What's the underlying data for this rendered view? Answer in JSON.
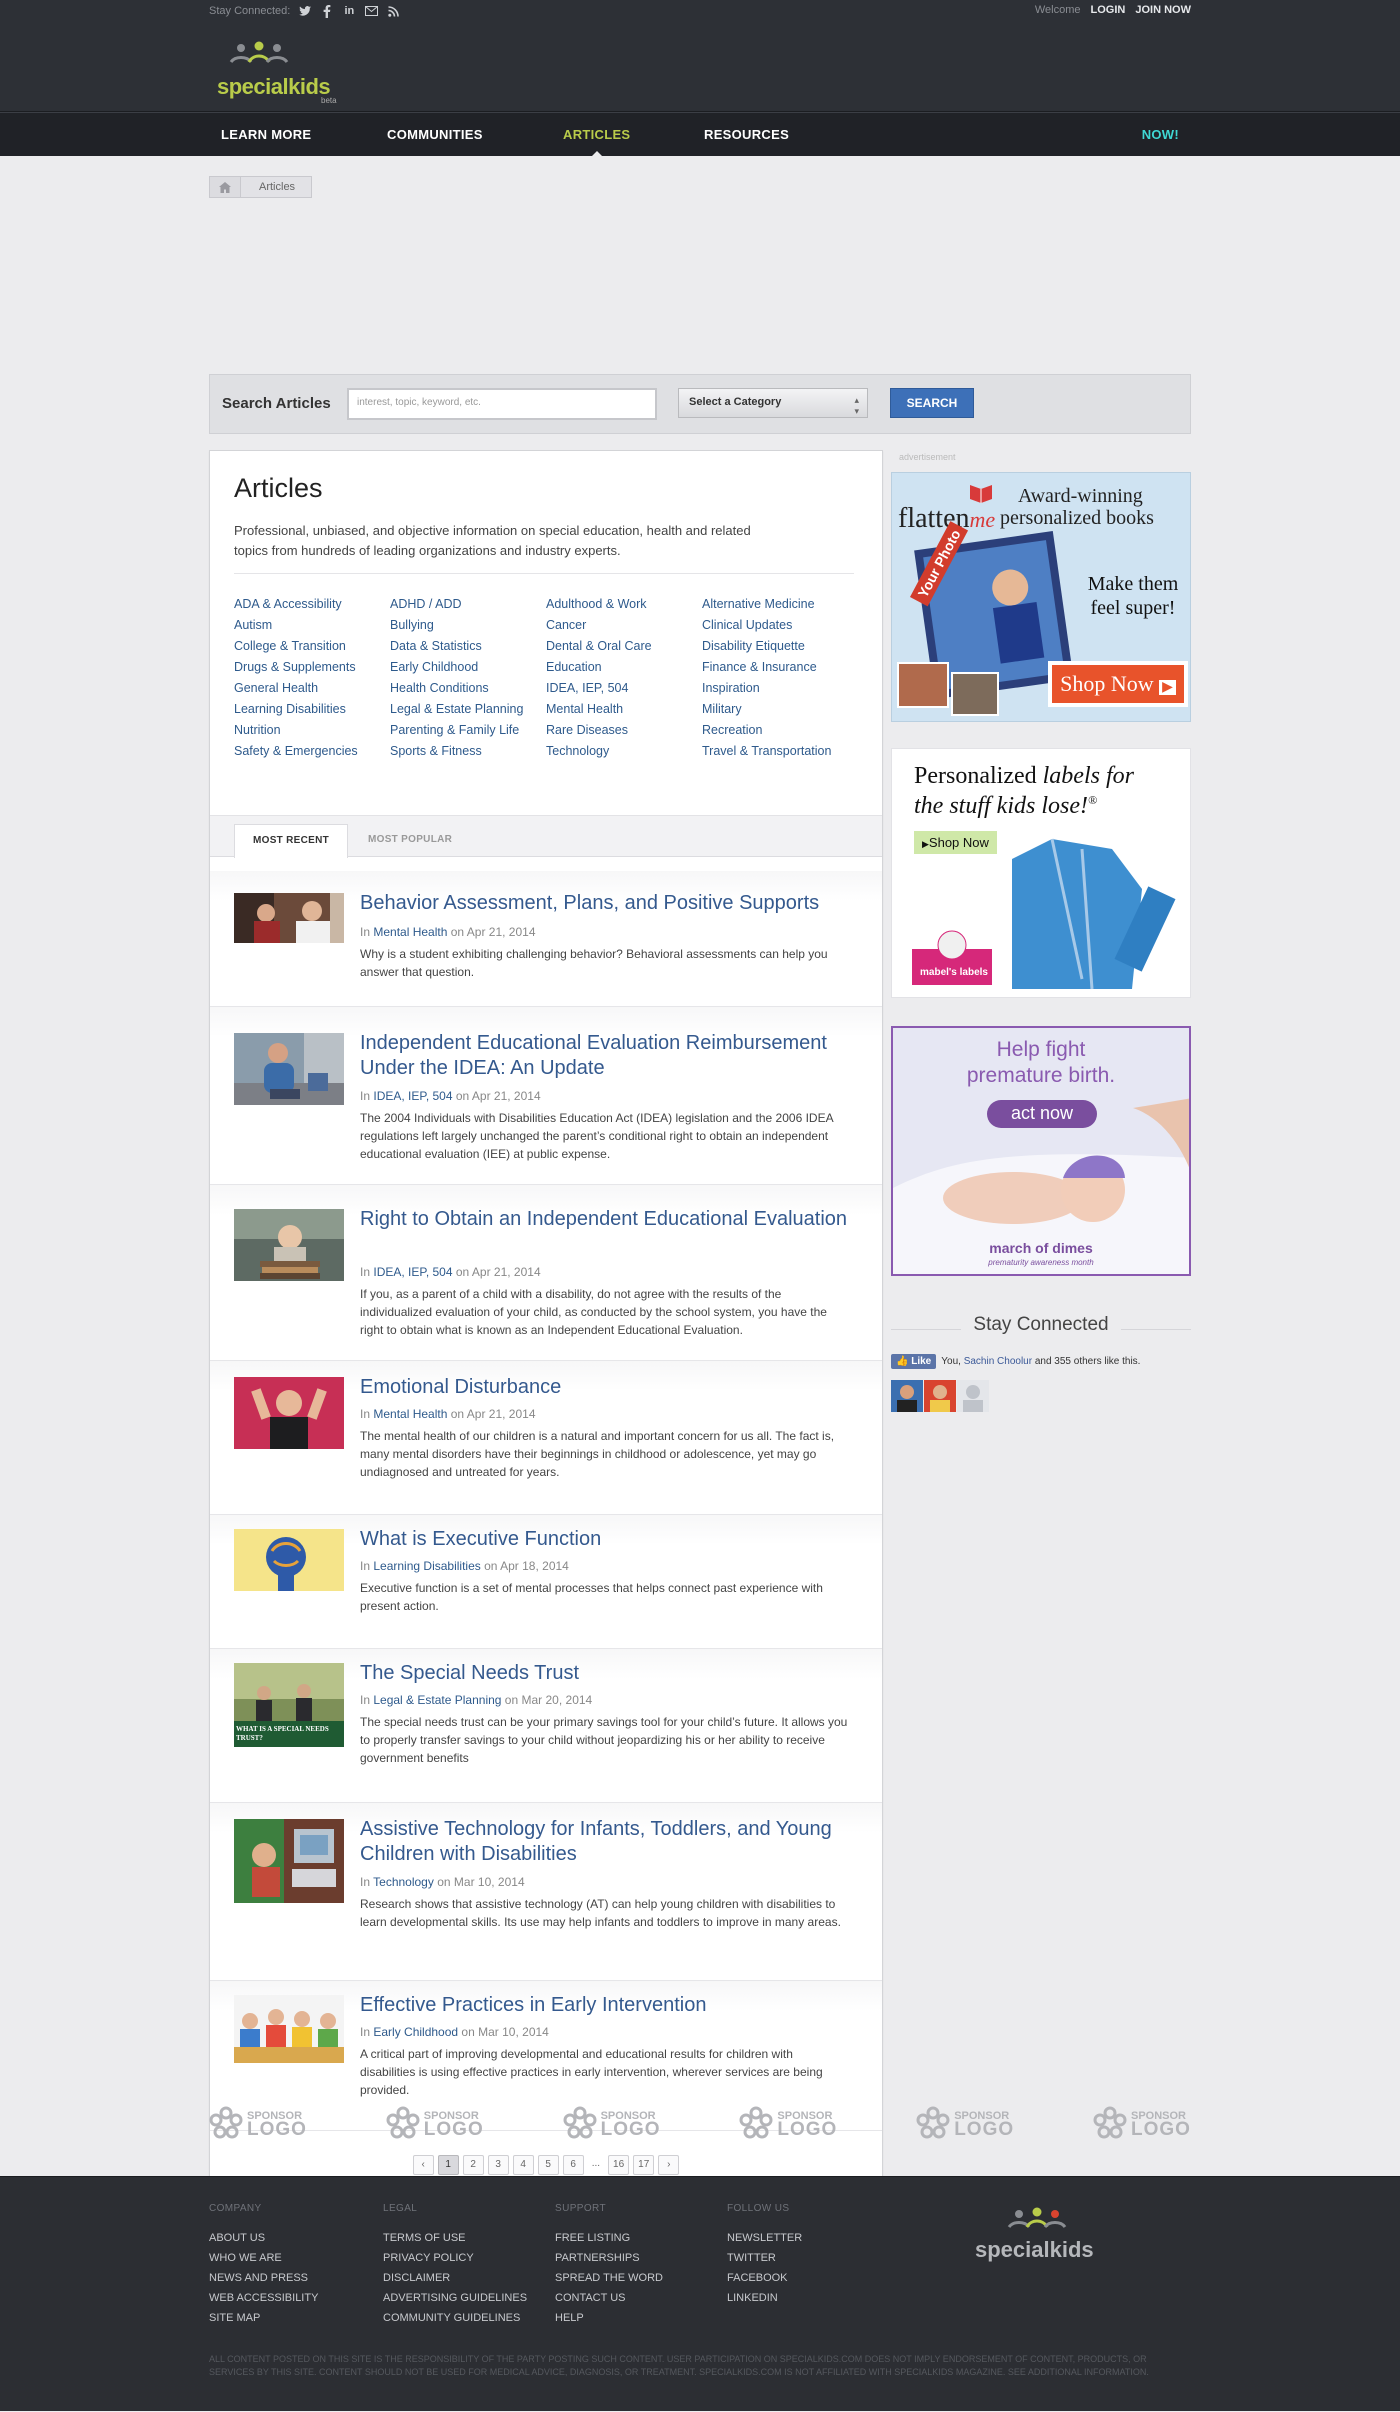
{
  "header": {
    "stay_connected": "Stay Connected:",
    "social_icons": [
      "twitter-icon",
      "facebook-icon",
      "linkedin-icon",
      "email-icon",
      "rss-icon"
    ],
    "welcome": "Welcome",
    "login": "LOGIN",
    "join": "JOIN NOW",
    "logo_text": "specialkids",
    "logo_beta": "beta"
  },
  "nav": {
    "items": [
      "LEARN MORE",
      "COMMUNITIES",
      "ARTICLES",
      "RESOURCES"
    ],
    "active": "ARTICLES",
    "now": "NOW!"
  },
  "breadcrumb": {
    "home_icon": "home-icon",
    "current": "Articles"
  },
  "search": {
    "label": "Search Articles",
    "placeholder": "interest, topic, keyword, etc.",
    "category": "Select a Category",
    "button": "SEARCH"
  },
  "articles_page": {
    "title": "Articles",
    "intro": "Professional, unbiased, and objective information on special education, health and related topics from hundreds of leading organizations and industry experts.",
    "categories": [
      "ADA & Accessibility",
      "ADHD / ADD",
      "Adulthood & Work",
      "Alternative Medicine",
      "Autism",
      "Bullying",
      "Cancer",
      "Clinical Updates",
      "College & Transition",
      "Data & Statistics",
      "Dental & Oral Care",
      "Disability Etiquette",
      "Drugs & Supplements",
      "Early Childhood",
      "Education",
      "Finance & Insurance",
      "General Health",
      "Health Conditions",
      "IDEA, IEP, 504",
      "Inspiration",
      "Learning Disabilities",
      "Legal & Estate Planning",
      "Mental Health",
      "Military",
      "Nutrition",
      "Parenting & Family Life",
      "Rare Diseases",
      "Recreation",
      "Safety & Emergencies",
      "Sports & Fitness",
      "Technology",
      "Travel & Transportation"
    ],
    "tabs": [
      "MOST RECENT",
      "MOST POPULAR"
    ],
    "in_label": "In",
    "on_label": "on",
    "list": [
      {
        "title": "Behavior Assessment, Plans, and Positive Supports",
        "category": "Mental Health",
        "date": "Apr 21, 2014",
        "desc": "Why is a student exhibiting challenging behavior? Behavioral assessments can help you answer that question."
      },
      {
        "title": "Independent Educational Evaluation Reimbursement Under the IDEA: An Update",
        "category": "IDEA, IEP, 504",
        "date": "Apr 21, 2014",
        "desc": "The 2004 Individuals with Disabilities Education Act (IDEA) legislation and the 2006 IDEA regulations left largely unchanged the parent’s conditional right to obtain an independent educational evaluation (IEE) at public expense."
      },
      {
        "title": "Right to Obtain an Independent Educational Evaluation",
        "category": "IDEA, IEP, 504",
        "date": "Apr 21, 2014",
        "desc": "If you, as a parent of a child with a disability, do not agree with the results of the individualized evaluation of your child, as conducted by the school system, you have the right to obtain what is known as an Independent Educational Evaluation."
      },
      {
        "title": "Emotional Disturbance",
        "category": "Mental Health",
        "date": "Apr 21, 2014",
        "desc": "The mental health of our children is a natural and important concern for us all. The fact is, many mental disorders have their beginnings in childhood or adolescence, yet may go undiagnosed and untreated for years."
      },
      {
        "title": "What is Executive Function",
        "category": "Learning Disabilities",
        "date": "Apr 18, 2014",
        "desc": "Executive function is a set of mental processes that helps connect past experience with present action."
      },
      {
        "title": "The Special Needs Trust",
        "category": "Legal & Estate Planning",
        "date": "Mar 20, 2014",
        "desc": "The special needs trust can be your primary savings tool for your child’s future. It allows you to properly transfer savings to your child without jeopardizing his or her ability to receive government benefits"
      },
      {
        "title": "Assistive Technology for Infants, Toddlers, and Young Children with Disabilities",
        "category": "Technology",
        "date": "Mar 10, 2014",
        "desc": "Research shows that assistive technology (AT) can help young children with disabilities to learn developmental skills. Its use may help infants and toddlers to improve in many areas."
      },
      {
        "title": "Effective Practices in Early Intervention",
        "category": "Early Childhood",
        "date": "Mar 10, 2014",
        "desc": "A critical part of improving developmental and educational results for children with disabilities is using effective practices in early intervention, wherever services are being provided."
      }
    ],
    "thumb_caption": "WHAT IS A SPECIAL NEEDS TRUST?",
    "pagination": [
      "‹",
      "1",
      "2",
      "3",
      "4",
      "5",
      "6",
      "...",
      "16",
      "17",
      "›"
    ],
    "current_page": "1"
  },
  "sidebar": {
    "ad_label": "advertisement",
    "ad1": {
      "line1": "Award-winning",
      "line2": "personalized books",
      "brand": "flatten",
      "brand_me": "me",
      "line3": "Make them",
      "line4": "feel super!",
      "cta": "Shop Now",
      "badge": "Your Photo"
    },
    "ad2": {
      "line1": "Personalized",
      "line1b": "labels for",
      "line2": "the stuff kids lose!",
      "mark": "®",
      "cta": "Shop Now",
      "brand": "mabel's labels"
    },
    "ad3": {
      "line1": "Help fight",
      "line2": "premature birth.",
      "cta": "act now",
      "brand": "march of dimes",
      "tagline": "prematurity awareness month"
    },
    "stay_title": "Stay Connected",
    "fb_like": "Like",
    "fb_text_you": "You,",
    "fb_name": "Sachin Choolur",
    "fb_text_rest": "and 355 others like this."
  },
  "sponsors": {
    "items": [
      "SPONSOR LOGO",
      "SPONSOR LOGO",
      "SPONSOR LOGO",
      "SPONSOR LOGO",
      "SPONSOR LOGO",
      "SPONSOR LOGO"
    ],
    "top": "SPONSOR",
    "bottom": "LOGO"
  },
  "footer": {
    "columns": [
      {
        "heading": "COMPANY",
        "links": [
          "ABOUT US",
          "WHO WE ARE",
          "NEWS AND PRESS",
          "WEB ACCESSIBILITY",
          "SITE MAP"
        ]
      },
      {
        "heading": "LEGAL",
        "links": [
          "TERMS OF USE",
          "PRIVACY POLICY",
          "DISCLAIMER",
          "ADVERTISING GUIDELINES",
          "COMMUNITY GUIDELINES"
        ]
      },
      {
        "heading": "SUPPORT",
        "links": [
          "FREE LISTING",
          "PARTNERSHIPS",
          "SPREAD THE WORD",
          "CONTACT US",
          "HELP"
        ]
      },
      {
        "heading": "FOLLOW US",
        "links": [
          "NEWSLETTER",
          "TWITTER",
          "FACEBOOK",
          "LINKEDIN"
        ]
      }
    ],
    "logo_text": "specialkids",
    "legal": "ALL CONTENT POSTED ON THIS SITE IS THE RESPONSIBILITY OF THE PARTY POSTING SUCH CONTENT. USER PARTICIPATION ON SPECIALKIDS.COM DOES NOT IMPLY ENDORSEMENT OF CONTENT, PRODUCTS, OR SERVICES BY THIS SITE. CONTENT SHOULD NOT BE USED FOR MEDICAL ADVICE, DIAGNOSIS, OR TREATMENT. SPECIALKIDS.COM IS NOT AFFILIATED WITH SPECIALKIDS MAGAZINE. SEE ADDITIONAL INFORMATION."
  },
  "colors": {
    "accent_green": "#b9cc4a",
    "link_blue": "#2e5a8c",
    "title_blue": "#34598e",
    "header_dark": "#2d3036",
    "now_cyan": "#3fd8d4",
    "search_button": "#3d70b8"
  }
}
